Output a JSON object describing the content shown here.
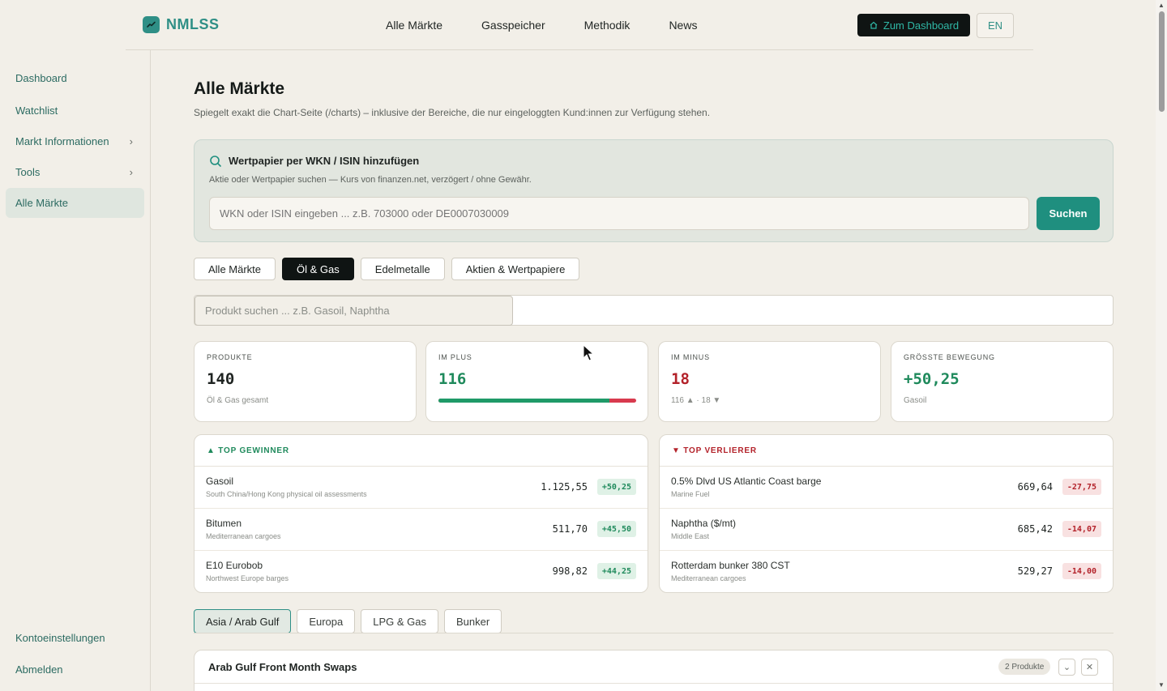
{
  "header": {
    "brand": "NMLSS",
    "nav": [
      "Alle Märkte",
      "Gasspeicher",
      "Methodik",
      "News"
    ],
    "dashboard_button": "Zum Dashboard",
    "lang_button": "EN",
    "accent_color": "#2f8f86"
  },
  "sidebar": {
    "items": [
      {
        "label": "Dashboard"
      },
      {
        "label": "Watchlist"
      },
      {
        "label": "Markt Informationen"
      },
      {
        "label": "Tools"
      },
      {
        "label": "Alle Märkte"
      }
    ],
    "bottom": [
      {
        "label": "Kontoeinstellungen"
      },
      {
        "label": "Abmelden"
      }
    ]
  },
  "page": {
    "title": "Alle Märkte",
    "subtitle": "Spiegelt exakt die Chart-Seite (/charts) – inklusive der Bereiche, die nur eingeloggten Kund:innen zur Verfügung stehen."
  },
  "wkn_search": {
    "title": "Wertpapier per WKN / ISIN hinzufügen",
    "subtitle": "Aktie oder Wertpapier suchen — Kurs von finanzen.net, verzögert / ohne Gewähr.",
    "placeholder": "WKN oder ISIN eingeben ... z.B. 703000 oder DE0007030009",
    "button": "Suchen"
  },
  "filter_tabs": [
    {
      "label": "Alle Märkte"
    },
    {
      "label": "Öl & Gas"
    },
    {
      "label": "Edelmetalle"
    },
    {
      "label": "Aktien & Wertpapiere"
    }
  ],
  "product_search": {
    "placeholder": "Produkt suchen ... z.B. Gasoil, Naphtha"
  },
  "stats": {
    "produkte": {
      "label": "PRODUKTE",
      "value": "140",
      "note": "Öl & Gas gesamt"
    },
    "plus": {
      "label": "IM PLUS",
      "value": "116",
      "ratio": 0.8657
    },
    "minus": {
      "label": "IM MINUS",
      "value": "18",
      "note": "116 ▲ · 18 ▼"
    },
    "biggest": {
      "label": "GRÖSSTE BEWEGUNG",
      "value": "+50,25",
      "note": "Gasoil"
    }
  },
  "top_gainers": {
    "title": "▲ TOP GEWINNER",
    "rows": [
      {
        "name": "Gasoil",
        "desc": "South China/Hong Kong physical oil assessments",
        "price": "1.125,55",
        "change": "+50,25"
      },
      {
        "name": "Bitumen",
        "desc": "Mediterranean cargoes",
        "price": "511,70",
        "change": "+45,50"
      },
      {
        "name": "E10 Eurobob",
        "desc": "Northwest Europe barges",
        "price": "998,82",
        "change": "+44,25"
      }
    ]
  },
  "top_losers": {
    "title": "▼ TOP VERLIERER",
    "rows": [
      {
        "name": "0.5% Dlvd US Atlantic Coast barge",
        "desc": "Marine Fuel",
        "price": "669,64",
        "change": "-27,75"
      },
      {
        "name": "Naphtha ($/mt)",
        "desc": "Middle East",
        "price": "685,42",
        "change": "-14,07"
      },
      {
        "name": "Rotterdam bunker 380 CST",
        "desc": "Mediterranean cargoes",
        "price": "529,27",
        "change": "-14,00"
      }
    ]
  },
  "region_tabs": [
    {
      "label": "Asia / Arab Gulf"
    },
    {
      "label": "Europa"
    },
    {
      "label": "LPG & Gas"
    },
    {
      "label": "Bunker"
    }
  ],
  "group": {
    "title": "Arab Gulf Front Month Swaps",
    "count": "2 Produkte"
  }
}
